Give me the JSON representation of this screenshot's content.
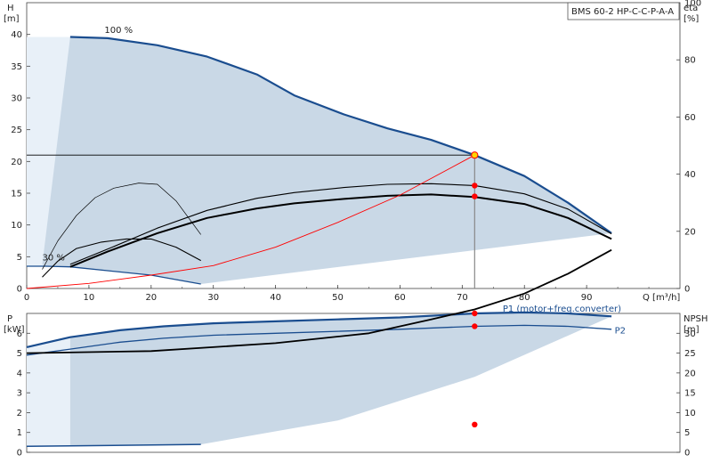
{
  "model_label": "BMS 60-2 HP-C-C-P-A-A",
  "colors": {
    "envelope": "#c9d8e6",
    "envelope_light": "#e8f0f8",
    "blue": "#1a4d8f",
    "black": "#000000",
    "red": "#ff0000",
    "gray": "#888888"
  },
  "chart_data": [
    {
      "type": "line",
      "name": "head",
      "xlabel": "Q [m³/h]",
      "x_ticks": [
        0,
        10,
        20,
        30,
        40,
        50,
        60,
        70,
        80,
        90
      ],
      "ylabel_left": "H",
      "ylabel_left_unit": "[m]",
      "ylim_left": [
        0,
        45
      ],
      "y_left_ticks": [
        0,
        5,
        10,
        15,
        20,
        25,
        30,
        35,
        40
      ],
      "ylabel_right": "eta",
      "ylabel_right_unit": "[%]",
      "ylim_right": [
        0,
        100
      ],
      "y_right_ticks": [
        0,
        20,
        40,
        60,
        80,
        100
      ],
      "xlim": [
        0,
        105
      ],
      "annotations": [
        {
          "text": "100 %",
          "x": 12.5,
          "y": 40.2
        },
        {
          "text": "30 %",
          "x": 2.5,
          "y": 4.4
        }
      ],
      "duty_point": {
        "x": 72,
        "y": 21
      },
      "eta_points": [
        {
          "x": 72,
          "y": 16.2
        },
        {
          "x": 72,
          "y": 14.5
        }
      ],
      "series": [
        {
          "role": "head_100",
          "x": [
            7,
            13,
            21,
            29,
            37,
            43,
            51,
            58,
            65,
            72,
            80,
            87,
            94
          ],
          "y": [
            39.6,
            39.4,
            38.3,
            36.5,
            33.7,
            30.4,
            27.4,
            25.2,
            23.4,
            21.0,
            17.7,
            13.5,
            8.7
          ]
        },
        {
          "role": "head_30",
          "x": [
            0,
            3,
            7,
            13,
            20,
            28
          ],
          "y": [
            3.5,
            3.5,
            3.4,
            2.8,
            2.1,
            0.7
          ]
        },
        {
          "role": "eta_100_upper",
          "x": [
            7,
            13,
            21,
            29,
            37,
            43,
            51,
            58,
            65,
            72,
            80,
            87,
            94
          ],
          "y": [
            3.8,
            6.2,
            9.5,
            12.3,
            14.2,
            15.1,
            15.9,
            16.4,
            16.5,
            16.2,
            14.9,
            12.5,
            8.6
          ]
        },
        {
          "role": "eta_100_lower",
          "x": [
            7,
            13,
            21,
            29,
            37,
            43,
            51,
            58,
            65,
            72,
            80,
            87,
            94
          ],
          "y": [
            3.4,
            5.8,
            8.7,
            11.1,
            12.6,
            13.4,
            14.1,
            14.6,
            14.8,
            14.4,
            13.3,
            11.1,
            7.8
          ]
        },
        {
          "role": "eta_30_upper",
          "x": [
            2.5,
            5,
            8,
            11,
            14,
            18,
            21,
            24,
            28
          ],
          "y": [
            3.0,
            7.5,
            11.5,
            14.3,
            15.8,
            16.6,
            16.4,
            13.8,
            8.5
          ]
        },
        {
          "role": "eta_30_lower",
          "x": [
            2.5,
            5,
            8,
            12,
            16,
            20,
            24,
            28
          ],
          "y": [
            1.8,
            4.3,
            6.3,
            7.3,
            7.8,
            7.8,
            6.5,
            4.4
          ]
        },
        {
          "role": "system_curve",
          "x": [
            0,
            10,
            20,
            30,
            40,
            50,
            60,
            72
          ],
          "y": [
            0,
            0.8,
            2.1,
            3.6,
            6.5,
            10.4,
            14.7,
            21.0
          ]
        }
      ],
      "envelope": {
        "x": [
          2.5,
          7,
          13,
          21,
          29,
          37,
          43,
          51,
          58,
          65,
          72,
          80,
          87,
          94,
          28,
          20,
          13,
          7,
          3,
          2.5
        ],
        "y": [
          3.8,
          39.6,
          39.4,
          38.3,
          36.5,
          33.7,
          30.4,
          27.4,
          25.2,
          23.4,
          21.0,
          17.7,
          13.5,
          8.7,
          0.7,
          2.1,
          2.8,
          3.4,
          3.5,
          3.8
        ]
      },
      "envelope_light": {
        "x": [
          0,
          7,
          7,
          3,
          0
        ],
        "y": [
          39.6,
          39.6,
          3.4,
          3.5,
          3.5
        ]
      }
    },
    {
      "type": "line",
      "name": "power",
      "xlabel": "",
      "x_ticks": [],
      "ylabel_left": "P",
      "ylabel_left_unit": "[kW]",
      "ylim_left": [
        0,
        7
      ],
      "y_left_ticks": [
        0,
        1,
        2,
        3,
        4,
        5,
        6
      ],
      "ylabel_right": "NPSH",
      "ylabel_right_unit": "[m]",
      "ylim_right": [
        0,
        35
      ],
      "y_right_ticks": [
        0,
        5,
        10,
        15,
        20,
        25,
        30
      ],
      "xlim": [
        0,
        105
      ],
      "series": [
        {
          "name": "P1 (motor+freq.converter)",
          "x": [
            0,
            7,
            15,
            22,
            30,
            40,
            50,
            60,
            72,
            80,
            87,
            94
          ],
          "y": [
            5.3,
            5.8,
            6.15,
            6.35,
            6.5,
            6.6,
            6.7,
            6.8,
            7.0,
            7.05,
            7.0,
            6.85
          ]
        },
        {
          "name": "P2",
          "x": [
            0,
            7,
            15,
            22,
            30,
            40,
            50,
            60,
            72,
            80,
            87,
            94
          ],
          "y": [
            4.9,
            5.2,
            5.55,
            5.75,
            5.9,
            6.0,
            6.1,
            6.2,
            6.35,
            6.4,
            6.35,
            6.2
          ]
        },
        {
          "role": "npsh",
          "x": [
            0,
            20,
            40,
            55,
            65,
            72,
            80,
            87,
            94
          ],
          "y": [
            5.0,
            5.1,
            5.5,
            6.0,
            6.7,
            7.2,
            8.0,
            9.0,
            10.2
          ]
        },
        {
          "role": "p_30_low",
          "x": [
            0,
            28
          ],
          "y": [
            0.3,
            0.4
          ]
        }
      ],
      "points": [
        {
          "x": 72,
          "y": 7.0
        },
        {
          "x": 72,
          "y": 6.35
        },
        {
          "x": 72,
          "y": 1.4
        }
      ],
      "envelope": {
        "x": [
          7,
          15,
          22,
          30,
          40,
          50,
          60,
          72,
          80,
          87,
          94,
          72,
          50,
          28,
          7
        ],
        "y": [
          5.8,
          6.15,
          6.35,
          6.5,
          6.6,
          6.7,
          6.8,
          7.0,
          7.05,
          7.0,
          6.85,
          3.8,
          1.6,
          0.4,
          0.3
        ]
      },
      "envelope_light": {
        "x": [
          0,
          7,
          7,
          0
        ],
        "y": [
          5.3,
          5.8,
          0.3,
          0.3
        ]
      }
    }
  ]
}
